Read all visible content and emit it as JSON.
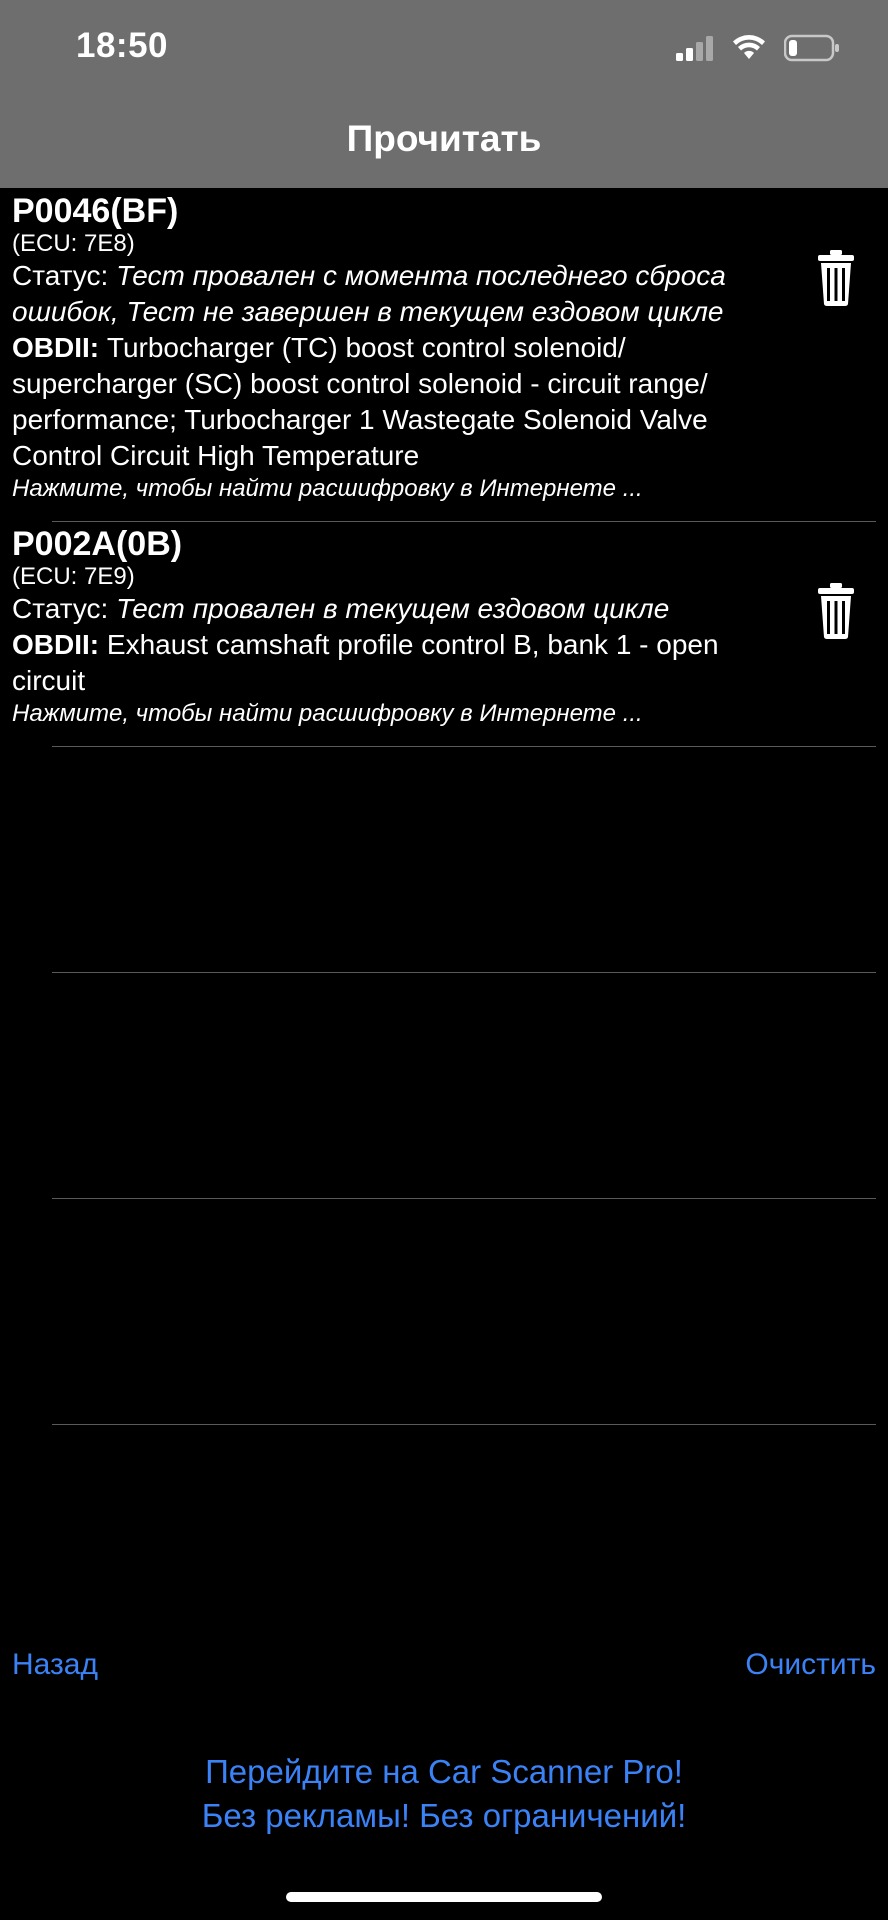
{
  "status_bar": {
    "time": "18:50",
    "signal_icon": "cellular-signal-icon",
    "wifi_icon": "wifi-icon",
    "battery_icon": "battery-low-icon"
  },
  "nav": {
    "title": "Прочитать"
  },
  "codes": [
    {
      "code": "P0046(BF)",
      "ecu": "(ECU: 7E8)",
      "status_label": "Статус: ",
      "status_value": "Тест провален с момента последнего сброса ошибок, Тест не завершен в текущем ездовом цикле",
      "obd_label": "OBDII: ",
      "obd_value": "Turbocharger (TC) boost control solenoid/ supercharger (SC) boost control solenoid - circuit range/ performance; Turbocharger 1 Wastegate Solenoid Valve Control Circuit High Temperature",
      "hint": "Нажмите, чтобы найти расшифровку в Интернете ..."
    },
    {
      "code": "P002A(0B)",
      "ecu": "(ECU: 7E9)",
      "status_label": "Статус: ",
      "status_value": "Тест провален в текущем ездовом цикле",
      "obd_label": "OBDII: ",
      "obd_value": "Exhaust camshaft profile control B, bank 1 - open circuit",
      "hint": "Нажмите, чтобы найти расшифровку в Интернете ..."
    }
  ],
  "footer": {
    "back_label": "Назад",
    "clear_label": "Очистить",
    "promo_line1": "Перейдите на Car Scanner Pro!",
    "promo_line2": "Без рекламы! Без ограничений!"
  },
  "colors": {
    "bar_bg": "#6e6e6e",
    "link": "#3b82f6",
    "separator": "#5a5a5a"
  }
}
